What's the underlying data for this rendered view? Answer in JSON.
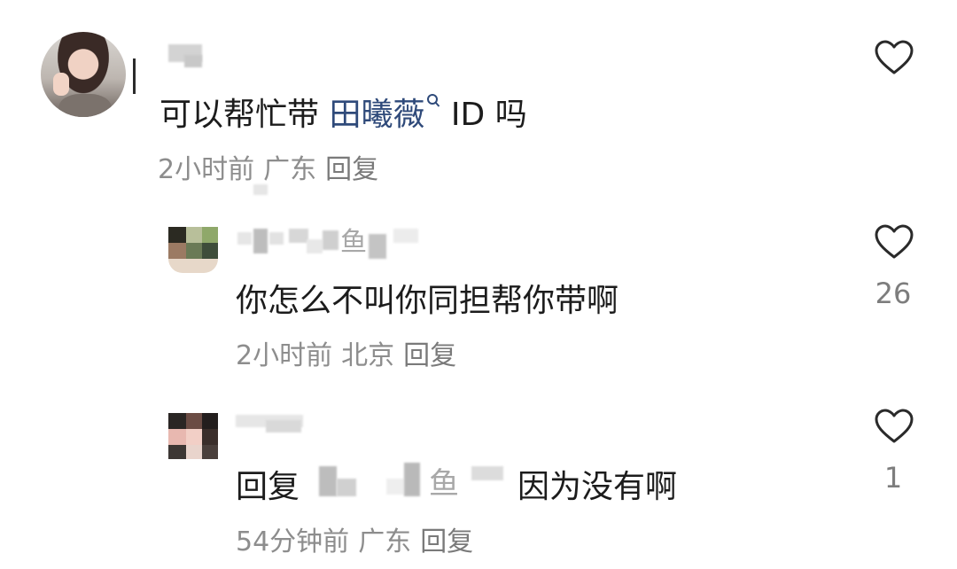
{
  "comments": [
    {
      "text_prefix": "可以帮忙带 ",
      "mention": "田曦薇",
      "text_suffix": " ID 吗",
      "time": "2小时前",
      "location": "广东",
      "reply_label": "回复",
      "likes": ""
    },
    {
      "username_char": "鱼",
      "text": "你怎么不叫你同担帮你带啊",
      "time": "2小时前",
      "location": "北京",
      "reply_label": "回复",
      "likes": "26"
    },
    {
      "reply_prefix": "回复",
      "mention_char": "鱼",
      "text": "因为没有啊",
      "time": "54分钟前",
      "location": "广东",
      "reply_label": "回复",
      "likes": "1"
    }
  ],
  "colors": {
    "text": "#1c1c1c",
    "meta": "#8d8d8d",
    "mention": "#2f4a7a",
    "heart_stroke": "#2a2a2a"
  },
  "icons": [
    "heart-icon",
    "search-icon"
  ]
}
